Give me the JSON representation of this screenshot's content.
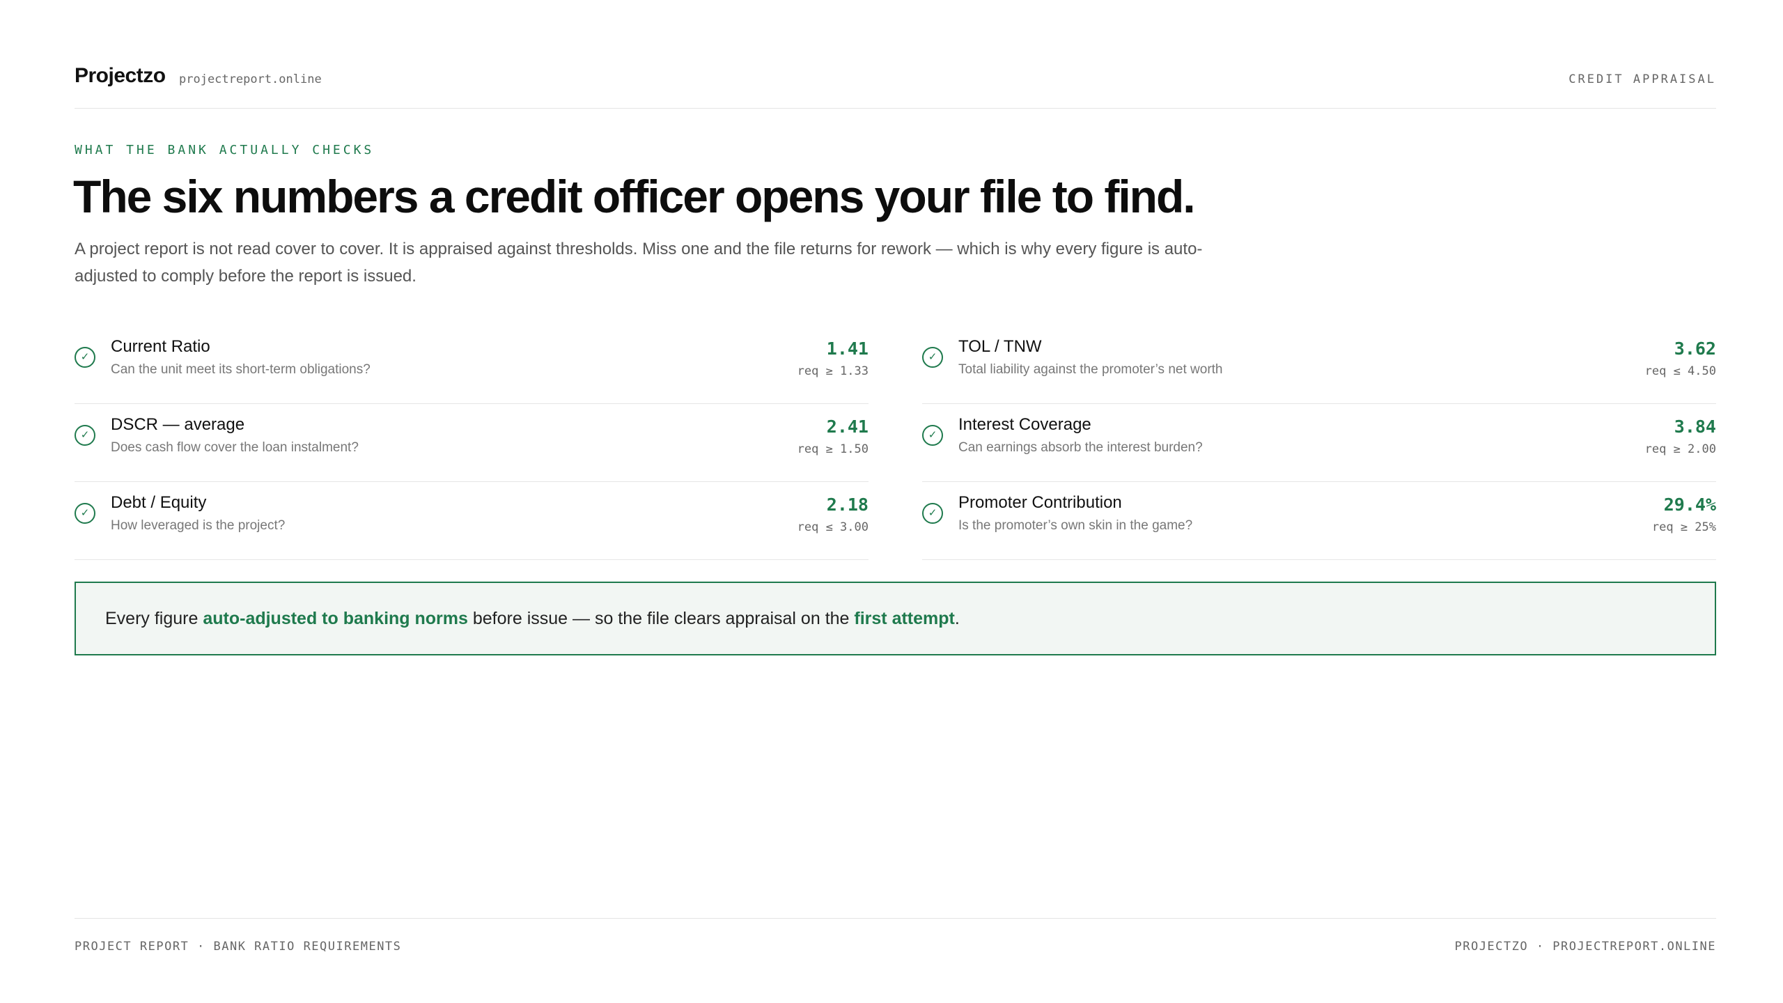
{
  "header": {
    "brand": "Projectzo",
    "domain": "projectreport.online",
    "tag": "CREDIT APPRAISAL"
  },
  "hero": {
    "eyebrow": "WHAT THE BANK ACTUALLY CHECKS",
    "headline": "The six numbers a credit officer opens your file to find.",
    "lede": "A project report is not read cover to cover. It is appraised against thresholds. Miss one and the file returns for rework — which is why every figure is auto-adjusted to comply before the report is issued."
  },
  "ratios": [
    {
      "name": "Current Ratio",
      "question": "Can the unit meet its short-term obligations?",
      "value": "1.41",
      "requirement": "req ≥ 1.33",
      "status": "pass",
      "icon": "check-icon"
    },
    {
      "name": "TOL / TNW",
      "question": "Total liability against the promoter’s net worth",
      "value": "3.62",
      "requirement": "req ≤ 4.50",
      "status": "pass",
      "icon": "check-icon"
    },
    {
      "name": "DSCR — average",
      "question": "Does cash flow cover the loan instalment?",
      "value": "2.41",
      "requirement": "req ≥ 1.50",
      "status": "pass",
      "icon": "check-icon"
    },
    {
      "name": "Interest Coverage",
      "question": "Can earnings absorb the interest burden?",
      "value": "3.84",
      "requirement": "req ≥ 2.00",
      "status": "pass",
      "icon": "check-icon"
    },
    {
      "name": "Debt / Equity",
      "question": "How leveraged is the project?",
      "value": "2.18",
      "requirement": "req ≤ 3.00",
      "status": "pass",
      "icon": "check-icon"
    },
    {
      "name": "Promoter Contribution",
      "question": "Is the promoter’s own skin in the game?",
      "value": "29.4%",
      "requirement": "req ≥ 25%",
      "status": "pass",
      "icon": "check-icon"
    }
  ],
  "callout": {
    "part1": "Every figure ",
    "highlight1": "auto-adjusted to banking norms",
    "part2": " before issue — so the file clears appraisal on the ",
    "highlight2": "first attempt",
    "part3": "."
  },
  "footer": {
    "left": "PROJECT REPORT · BANK RATIO REQUIREMENTS",
    "right": "PROJECTZO · PROJECTREPORT.ONLINE"
  },
  "colors": {
    "accent": "#1f7a4d",
    "callout_bg": "#f2f6f3",
    "text": "#111111",
    "muted": "#777777"
  }
}
